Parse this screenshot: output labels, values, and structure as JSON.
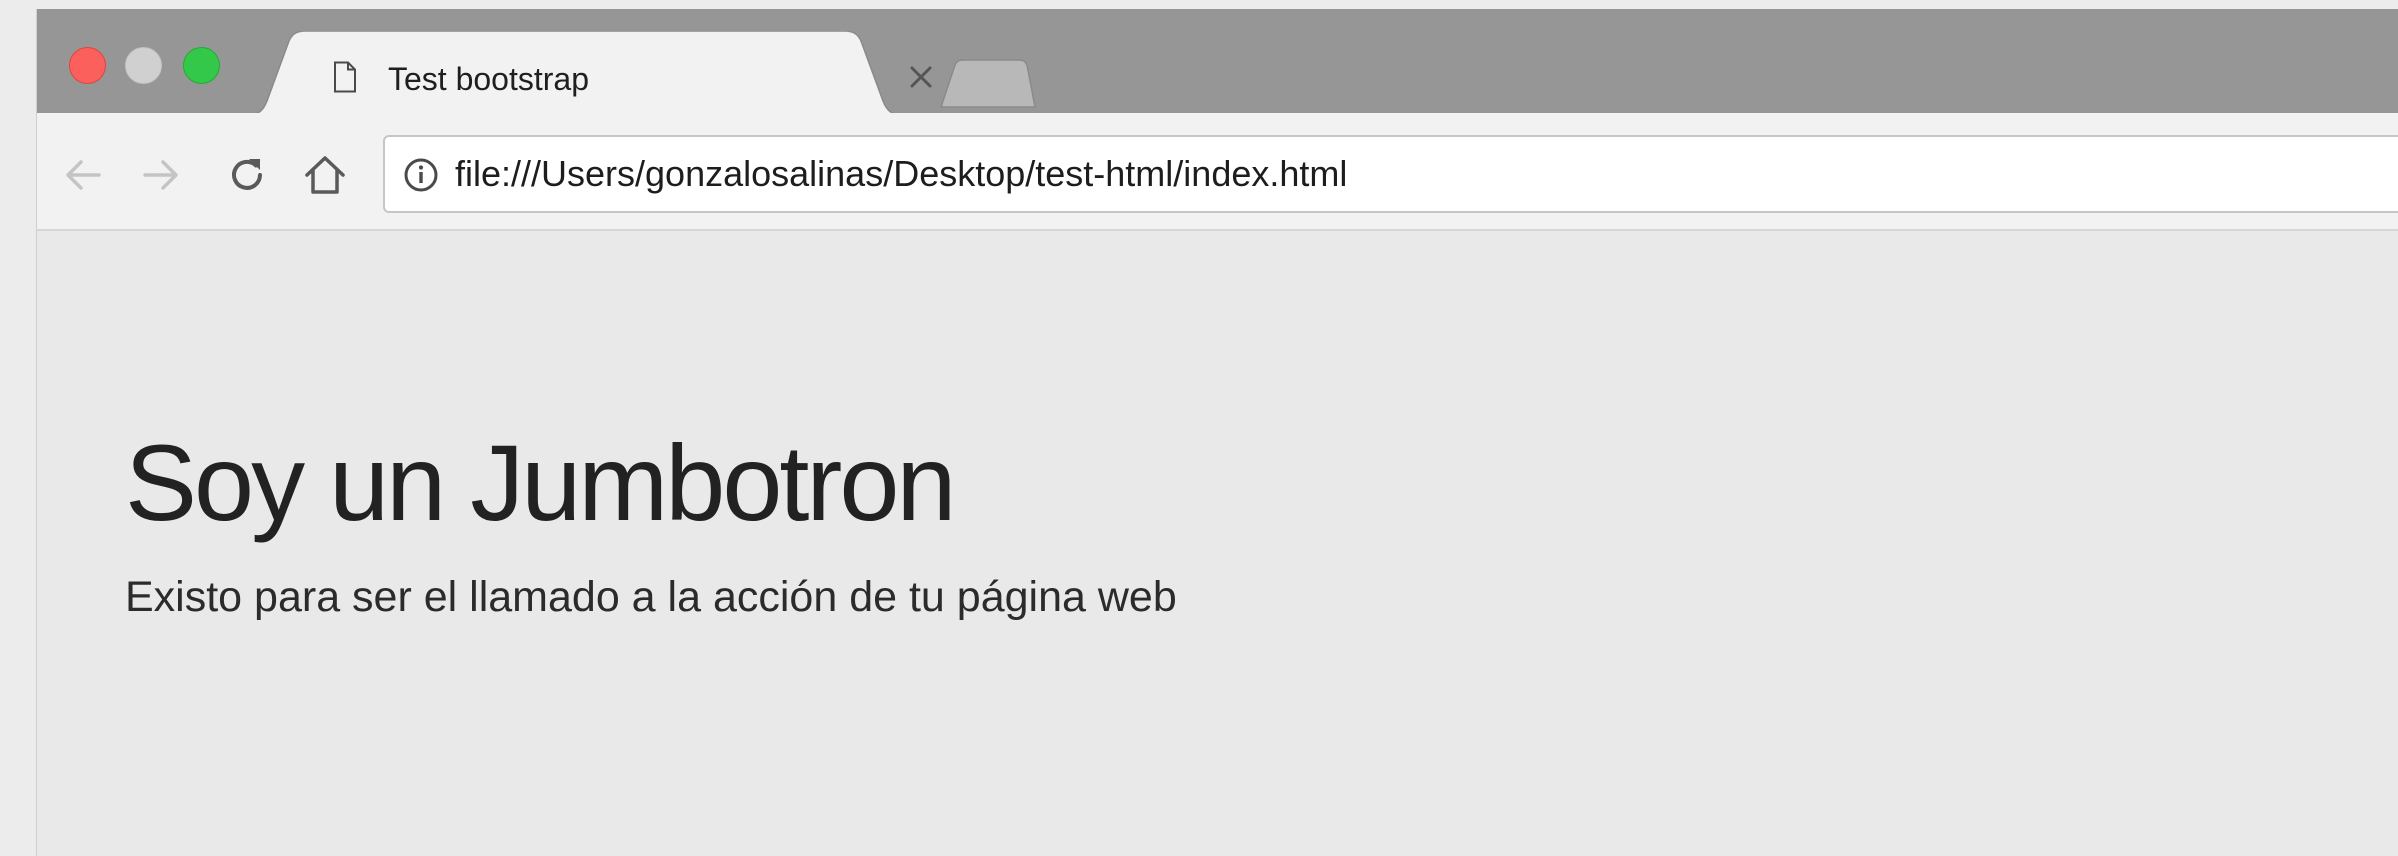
{
  "browser": {
    "tab": {
      "title": "Test bootstrap",
      "favicon": "document-icon",
      "close_icon": "close-icon"
    },
    "new_tab_icon": "new-tab-icon",
    "toolbar": {
      "back_icon": "arrow-left-icon",
      "forward_icon": "arrow-right-icon",
      "reload_icon": "reload-icon",
      "home_icon": "home-icon",
      "info_icon": "info-icon",
      "url": "file:///Users/gonzalosalinas/Desktop/test-html/index.html"
    },
    "traffic_lights": {
      "close": "#fc605c",
      "minimize": "#d0d0d0",
      "maximize": "#34c84a"
    }
  },
  "page": {
    "jumbotron": {
      "title": "Soy un Jumbotron",
      "lead": "Existo para ser el llamado a la acción de tu página web"
    }
  }
}
